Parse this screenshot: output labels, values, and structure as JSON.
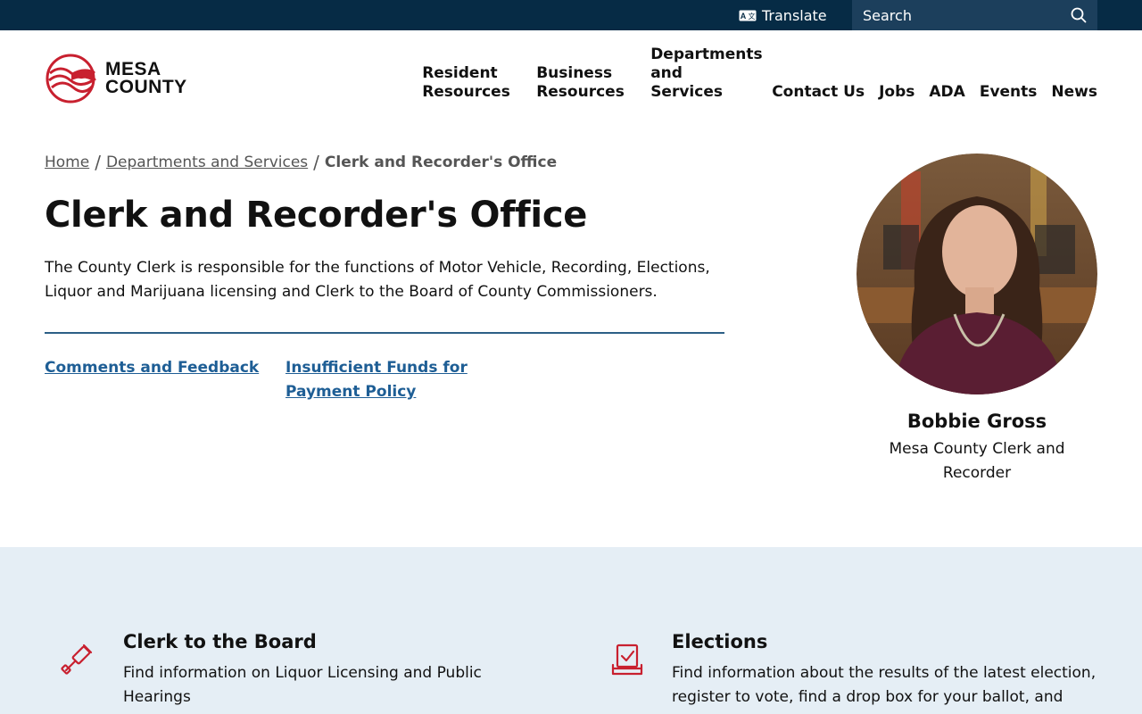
{
  "utility": {
    "translate_label": "Translate",
    "search_placeholder": "Search"
  },
  "logo": {
    "line1": "MESA",
    "line2": "COUNTY"
  },
  "nav": [
    {
      "line1": "Resident",
      "line2": "Resources"
    },
    {
      "line1": "Business",
      "line2": "Resources"
    },
    {
      "line1": "Departments",
      "line2": "and Services"
    },
    {
      "label": "Contact Us"
    },
    {
      "label": "Jobs"
    },
    {
      "label": "ADA"
    },
    {
      "label": "Events"
    },
    {
      "label": "News"
    }
  ],
  "breadcrumb": {
    "home": "Home",
    "separator": "/",
    "parent": "Departments and Services",
    "current": "Clerk and Recorder's Office"
  },
  "page": {
    "title": "Clerk and Recorder's Office",
    "intro": "The County Clerk is responsible for the functions of Motor Vehicle, Recording, Elections, Liquor and Marijuana licensing and Clerk to the Board of County Commissioners."
  },
  "quick_links": [
    {
      "label": "Comments and Feedback"
    },
    {
      "label": "Insufficient Funds for Payment Policy"
    }
  ],
  "profile": {
    "name": "Bobbie Gross",
    "role": "Mesa County Clerk and Recorder"
  },
  "services": [
    {
      "title": "Clerk to the Board",
      "description": "Find information on Liquor Licensing and Public Hearings",
      "icon": "gavel-icon"
    },
    {
      "title": "Elections",
      "description": "Find information about the results of the latest election, register to vote, find a drop box for your ballot, and",
      "icon": "ballot-box-icon"
    }
  ],
  "colors": {
    "utility_bar": "#062b45",
    "search_bg": "#1c3f5c",
    "brand_red": "#c8202f",
    "link_blue": "#1e5e95",
    "band_bg": "#e5eef5"
  }
}
